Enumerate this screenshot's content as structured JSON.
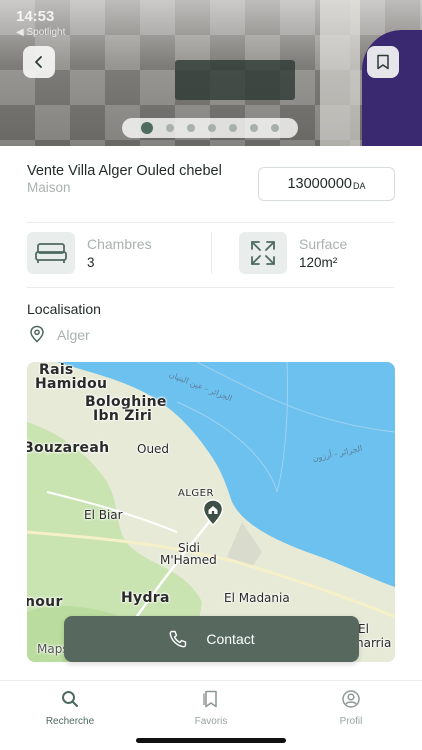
{
  "status_bar": {
    "time": "14:53",
    "carrier": "◀ Spotlight"
  },
  "gallery": {
    "image_count": 7,
    "active_index": 0
  },
  "listing": {
    "title": "Vente Villa Alger Ouled chebel",
    "type": "Maison",
    "price": "13000000",
    "currency": "DA"
  },
  "features": [
    {
      "label": "Chambres",
      "value": "3",
      "icon": "bed-icon"
    },
    {
      "label": "Surface",
      "value": "120m²",
      "icon": "expand-arrows-icon"
    }
  ],
  "location": {
    "section_title": "Localisation",
    "city": "Alger"
  },
  "map": {
    "labels": {
      "rais_hamidou_1": "Rais",
      "rais_hamidou_2": "Hamidou",
      "bologhine_1": "Bologhine",
      "bologhine_2": "Ibn Ziri",
      "bouzareah": "Bouzareah",
      "oued": "Oued",
      "alger": "ALGER",
      "el_biar": "El Biar",
      "sidi_mhamed_1": "Sidi",
      "sidi_mhamed_2": "M'Hamed",
      "hydra": "Hydra",
      "el_madania": "El Madania",
      "nour": "nour",
      "el": "El",
      "harrach": "harria",
      "arabic_1": "الجزائر - عين البنيان",
      "arabic_2": "الجزائر - أرزون",
      "watermark": "Maps"
    },
    "colors": {
      "sea": "#6cc1ee",
      "land": "#e6ead7",
      "green": "#bfe0a4"
    }
  },
  "contact_button": {
    "label": "Contact"
  },
  "bottom_nav": [
    {
      "label": "Recherche",
      "icon": "search-icon",
      "active": true
    },
    {
      "label": "Favoris",
      "icon": "bookmarks-icon",
      "active": false
    },
    {
      "label": "Profil",
      "icon": "profile-icon",
      "active": false
    }
  ],
  "colors": {
    "accent": "#57695f",
    "muted_text": "#a8b2ae",
    "icon_bg": "#e9edeb"
  }
}
